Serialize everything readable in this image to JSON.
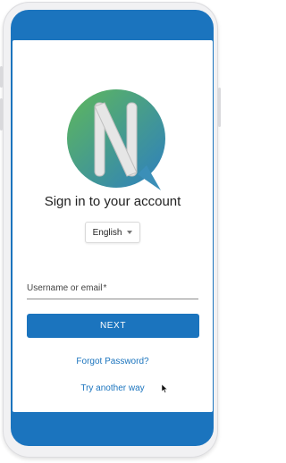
{
  "login": {
    "heading": "Sign in to your account",
    "language": "English",
    "username_label": "Username or email",
    "required_mark": "*",
    "next_label": "NEXT",
    "forgot_link": "Forgot Password?",
    "alt_link": "Try another way"
  },
  "icons": {
    "logo": "n-speech-bubble-logo",
    "language_caret": "caret-down-icon",
    "cursor": "mouse-pointer-icon"
  },
  "colors": {
    "primary": "#1b74be",
    "logo_green": "#5fb85a",
    "logo_blue": "#2d7fc0",
    "text": "#222222"
  }
}
